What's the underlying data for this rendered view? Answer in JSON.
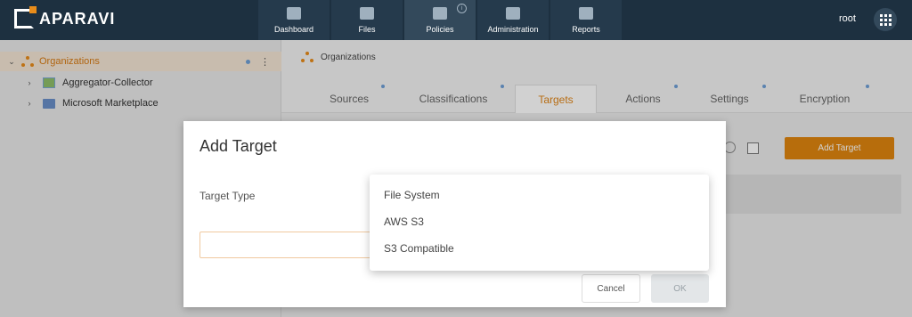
{
  "app": {
    "brand": "APARAVI",
    "user": "root"
  },
  "nav": [
    {
      "label": "Dashboard",
      "icon": "dashboard-icon",
      "active": false
    },
    {
      "label": "Files",
      "icon": "folder-icon",
      "active": false
    },
    {
      "label": "Policies",
      "icon": "policies-icon",
      "active": true
    },
    {
      "label": "Administration",
      "icon": "people-icon",
      "active": false
    },
    {
      "label": "Reports",
      "icon": "clipboard-icon",
      "active": false
    }
  ],
  "tree": {
    "root": "Organizations",
    "children": [
      "Aggregator-Collector",
      "Microsoft Marketplace"
    ]
  },
  "breadcrumb": "Organizations",
  "tabs": [
    "Sources",
    "Classifications",
    "Targets",
    "Actions",
    "Settings",
    "Encryption"
  ],
  "active_tab": "Targets",
  "add_target_button": "Add Target",
  "modal": {
    "title": "Add Target",
    "field_label": "Target Type",
    "options": [
      "File System",
      "AWS S3",
      "S3 Compatible"
    ],
    "cancel": "Cancel",
    "ok": "OK"
  },
  "colors": {
    "accent": "#e0860f",
    "topbar": "#1d3040"
  }
}
